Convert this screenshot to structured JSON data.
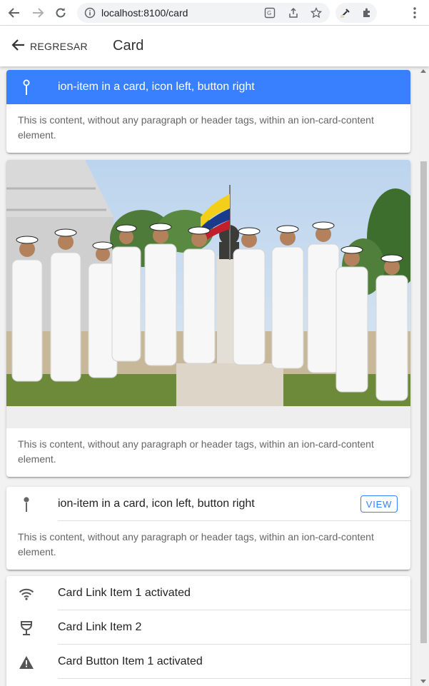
{
  "browser": {
    "url": "localhost:8100/card"
  },
  "header": {
    "back_label": "REGRESAR",
    "title": "Card"
  },
  "cards": [
    {
      "item_label": "ion-item in a card, icon left, button right",
      "item_icon": "pin-icon",
      "content": "This is content, without any paragraph or header tags, within an ion-card-content element."
    },
    {
      "image_description_icon": "photo",
      "content": "This is content, without any paragraph or header tags, within an ion-card-content element."
    },
    {
      "item_label": "ion-item in a card, icon left, button right",
      "item_icon": "pin-icon",
      "button_label": "VIEW",
      "content": "This is content, without any paragraph or header tags, within an ion-card-content element."
    }
  ],
  "list_card": {
    "items": [
      {
        "icon": "wifi-icon",
        "label": "Card Link Item 1 activated"
      },
      {
        "icon": "wine-icon",
        "label": "Card Link Item 2"
      },
      {
        "icon": "warning-icon",
        "label": "Card Button Item 1 activated"
      }
    ]
  },
  "colors": {
    "primary": "#3880ff"
  }
}
